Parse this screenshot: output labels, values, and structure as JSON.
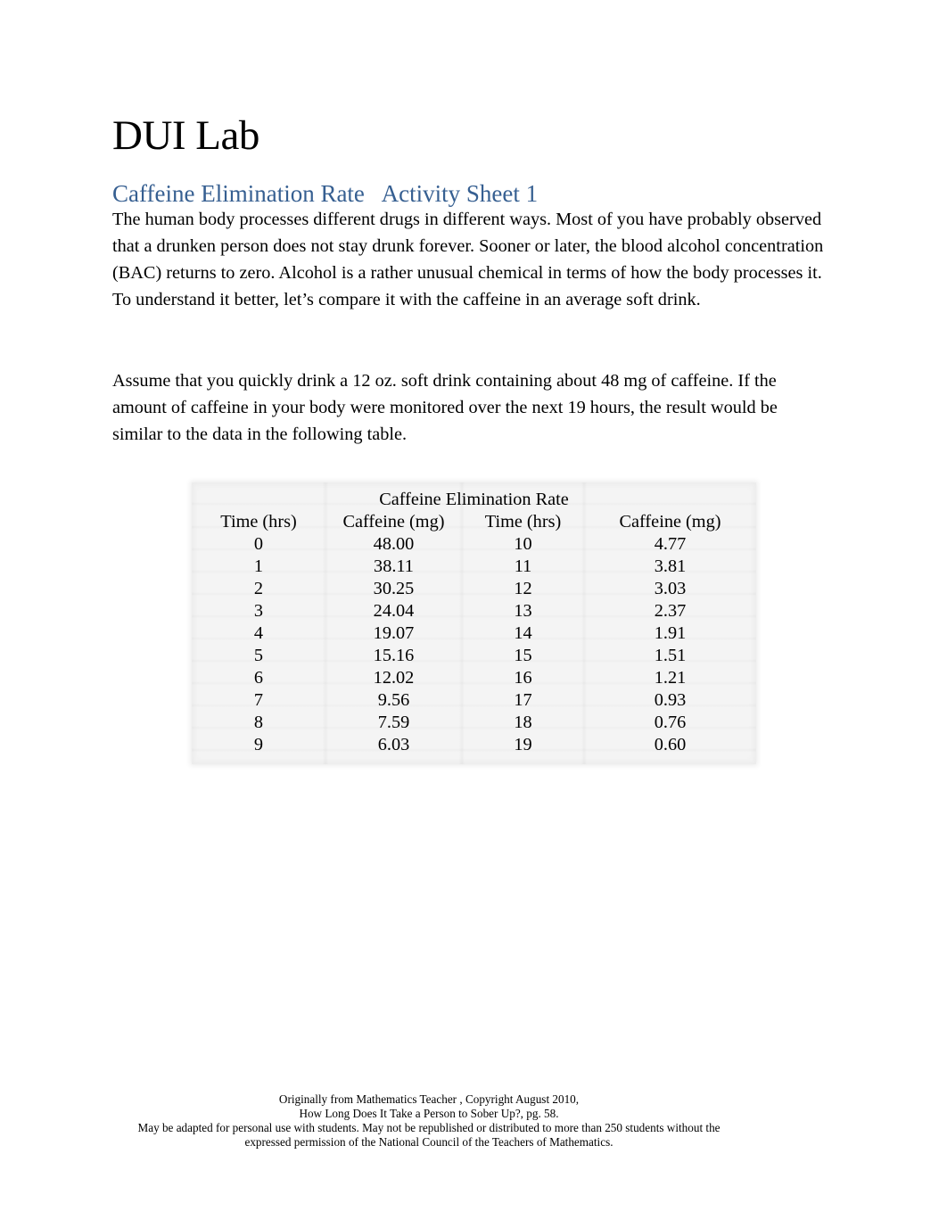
{
  "document": {
    "title": "DUI Lab",
    "subtitle": "Caffeine Elimination Rate   Activity Sheet 1",
    "paragraphs": [
      "The human body processes different drugs in different ways. Most of you have probably observed that a drunken person does not stay drunk forever. Sooner or later, the blood alcohol concentration (BAC) returns to zero. Alcohol is a rather unusual chemical in terms of how the body processes it. To understand it better, let’s compare it with the caffeine in an average soft drink.",
      "Assume that you quickly drink a 12 oz. soft drink containing about 48 mg of caffeine. If the amount of caffeine in your body were monitored over the next 19 hours, the result would be similar to the data in the following table."
    ],
    "subtitle_color": "#365f91"
  },
  "table": {
    "caption": "Caffeine Elimination Rate",
    "headers": [
      "Time (hrs)",
      "Caffeine (mg)",
      "Time (hrs)",
      "Caffeine (mg)"
    ],
    "rows": [
      [
        "0",
        "48.00",
        "10",
        "4.77"
      ],
      [
        "1",
        "38.11",
        "11",
        "3.81"
      ],
      [
        "2",
        "30.25",
        "12",
        "3.03"
      ],
      [
        "3",
        "24.04",
        "13",
        "2.37"
      ],
      [
        "4",
        "19.07",
        "14",
        "1.91"
      ],
      [
        "5",
        "15.16",
        "15",
        "1.51"
      ],
      [
        "6",
        "12.02",
        "16",
        "1.21"
      ],
      [
        "7",
        "9.56",
        "17",
        "0.93"
      ],
      [
        "8",
        "7.59",
        "18",
        "0.76"
      ],
      [
        "9",
        "6.03",
        "19",
        "0.60"
      ]
    ]
  },
  "footer": {
    "lines": [
      "Originally from  Mathematics Teacher     , Copyright August 2010,",
      "How Long Does It Take a Person to Sober Up?, pg. 58.",
      "May be adapted for personal use with students. May not be republished or distributed to more than 250 students without the",
      "expressed permission of the National Council of the Teachers of Mathematics."
    ]
  }
}
